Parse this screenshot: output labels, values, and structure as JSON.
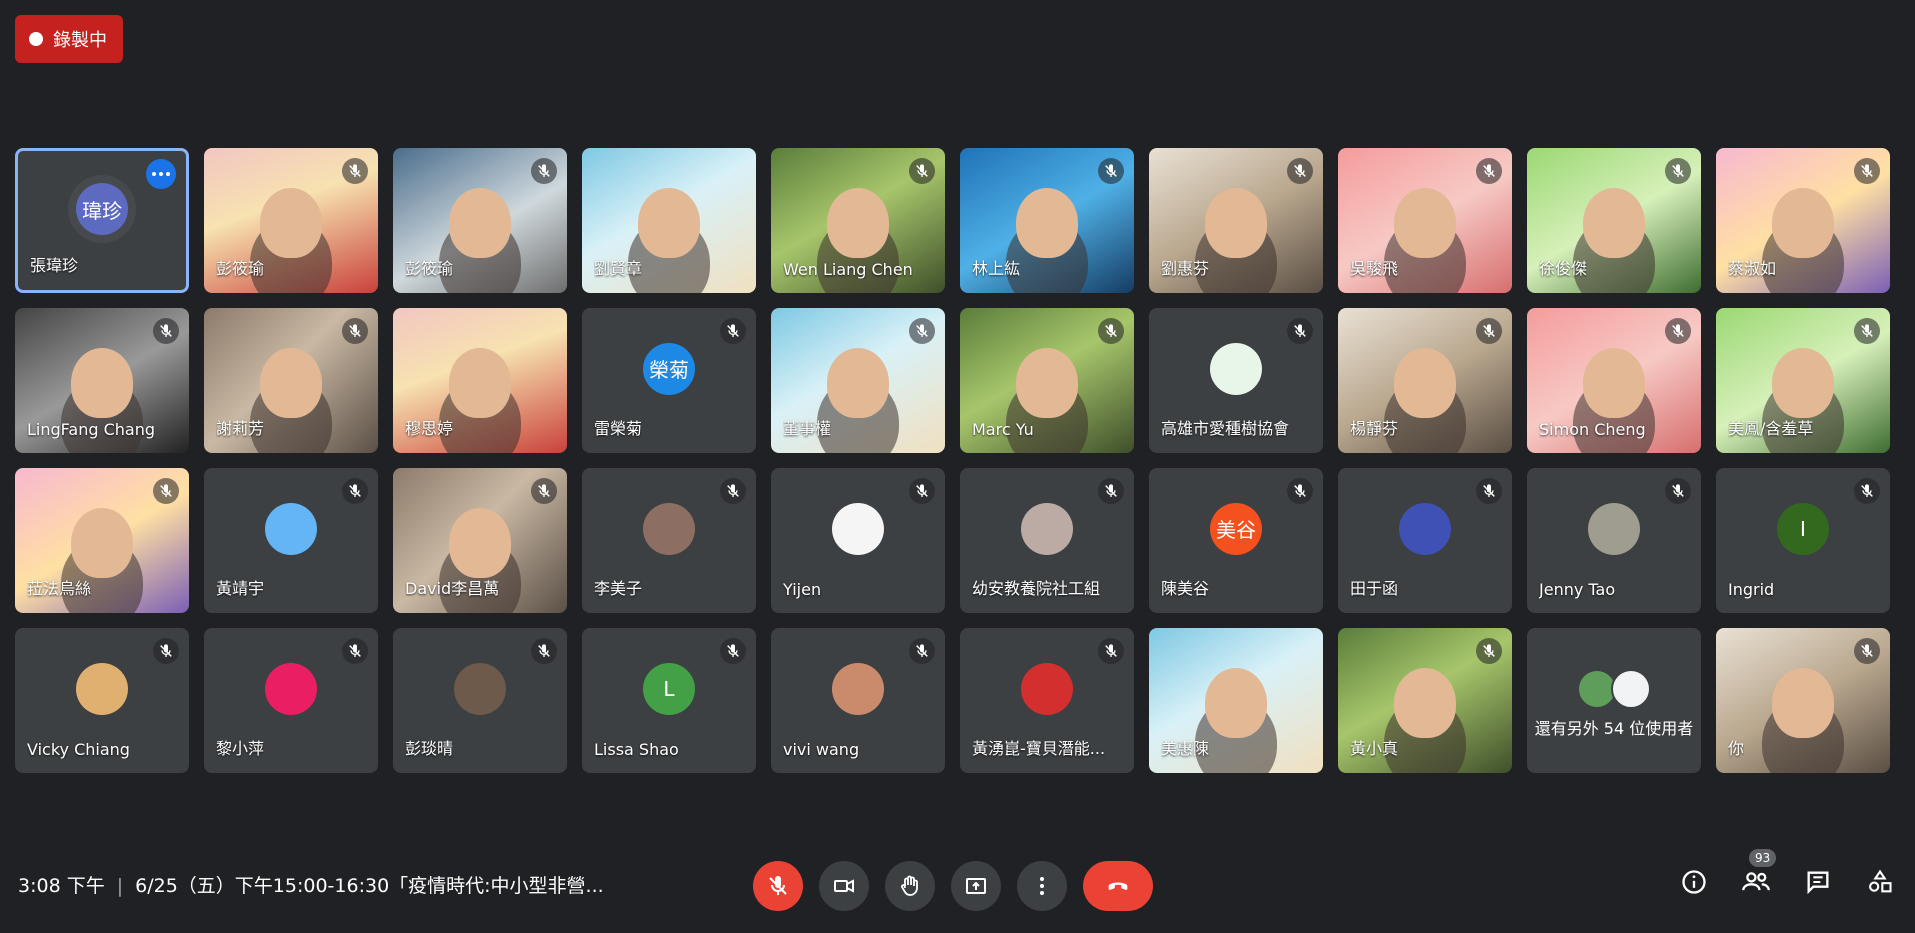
{
  "recording": {
    "label": "錄製中"
  },
  "participants": [
    {
      "name": "張瑋珍",
      "type": "avatar",
      "initials": "瑋珍",
      "avatar_color": "#5c6bc0",
      "active": true
    },
    {
      "name": "彭筱瑜",
      "type": "video",
      "muted": true
    },
    {
      "name": "彭筱瑜",
      "type": "video",
      "muted": true
    },
    {
      "name": "劉賢章",
      "type": "video",
      "muted": false
    },
    {
      "name": "Wen Liang Chen",
      "type": "video",
      "muted": true
    },
    {
      "name": "林上紘",
      "type": "video",
      "muted": true
    },
    {
      "name": "劉惠芬",
      "type": "video",
      "muted": true
    },
    {
      "name": "吳駿飛",
      "type": "video",
      "muted": true
    },
    {
      "name": "徐俊傑",
      "type": "video",
      "muted": true
    },
    {
      "name": "蔡淑如",
      "type": "video",
      "muted": true
    },
    {
      "name": "LingFang Chang",
      "type": "video",
      "muted": true
    },
    {
      "name": "謝莉芳",
      "type": "video",
      "muted": true
    },
    {
      "name": "穆思婷",
      "type": "video",
      "muted": false
    },
    {
      "name": "雷榮菊",
      "type": "avatar",
      "initials": "榮菊",
      "avatar_color": "#1e88e5",
      "muted": true
    },
    {
      "name": "董事權",
      "type": "video",
      "muted": true
    },
    {
      "name": "Marc Yu",
      "type": "video",
      "muted": true
    },
    {
      "name": "高雄市愛種樹協會",
      "type": "avatar",
      "initials": "",
      "avatar_color": "#e8f5e9",
      "muted": true
    },
    {
      "name": "楊靜芬",
      "type": "video",
      "muted": true
    },
    {
      "name": "Simon Cheng",
      "type": "video",
      "muted": true
    },
    {
      "name": "美鳳/含羞草",
      "type": "video",
      "muted": true
    },
    {
      "name": "菈法烏絲",
      "type": "video",
      "muted": true
    },
    {
      "name": "黃靖宇",
      "type": "avatar",
      "initials": "",
      "avatar_color": "#64b5f6",
      "muted": true
    },
    {
      "name": "David李昌萬",
      "type": "video",
      "muted": true
    },
    {
      "name": "李美子",
      "type": "avatar",
      "initials": "",
      "avatar_color": "#8d6e63",
      "muted": true
    },
    {
      "name": "Yijen",
      "type": "avatar",
      "initials": "",
      "avatar_color": "#f5f5f5",
      "muted": true
    },
    {
      "name": "幼安教養院社工組",
      "type": "avatar",
      "initials": "",
      "avatar_color": "#bcaaa4",
      "muted": true
    },
    {
      "name": "陳美谷",
      "type": "avatar",
      "initials": "美谷",
      "avatar_color": "#f4511e",
      "muted": true
    },
    {
      "name": "田于函",
      "type": "avatar",
      "initials": "",
      "avatar_color": "#3f51b5",
      "muted": true
    },
    {
      "name": "Jenny Tao",
      "type": "avatar",
      "initials": "",
      "avatar_color": "#9e9d8f",
      "muted": true
    },
    {
      "name": "Ingrid",
      "type": "avatar",
      "initials": "I",
      "avatar_color": "#33691e",
      "muted": true
    },
    {
      "name": "Vicky Chiang",
      "type": "avatar",
      "initials": "",
      "avatar_color": "#e0b070",
      "muted": true
    },
    {
      "name": "黎小萍",
      "type": "avatar",
      "initials": "",
      "avatar_color": "#e91e63",
      "muted": true
    },
    {
      "name": "彭琰晴",
      "type": "avatar",
      "initials": "",
      "avatar_color": "#6d5a4a",
      "muted": true
    },
    {
      "name": "Lissa Shao",
      "type": "avatar",
      "initials": "L",
      "avatar_color": "#43a047",
      "muted": true
    },
    {
      "name": "vivi wang",
      "type": "avatar",
      "initials": "",
      "avatar_color": "#c98b6b",
      "muted": true
    },
    {
      "name": "黃湧崑-寶貝潛能...",
      "type": "avatar",
      "initials": "",
      "avatar_color": "#d32f2f",
      "muted": true
    },
    {
      "name": "美惠陳",
      "type": "video",
      "muted": false
    },
    {
      "name": "黃小真",
      "type": "video",
      "muted": true
    },
    {
      "name": "還有另外 54 位使用者",
      "type": "others"
    },
    {
      "name": "你",
      "type": "video",
      "muted": true
    }
  ],
  "bottom": {
    "time": "3:08 下午",
    "meeting_title": "6/25（五）下午15:00-16:30「疫情時代:中小型非營...",
    "participant_count": "93"
  },
  "icons": {
    "mic": "mic-off-icon",
    "camera": "camera-icon",
    "hand": "raise-hand-icon",
    "present": "present-screen-icon",
    "more": "more-options-icon",
    "hangup": "hang-up-icon",
    "info": "info-icon",
    "people": "people-icon",
    "chat": "chat-icon",
    "activities": "activities-icon"
  },
  "colors": {
    "background": "#202124",
    "tile": "#3c4043",
    "danger": "#ea4335",
    "accent": "#8ab4f8"
  }
}
